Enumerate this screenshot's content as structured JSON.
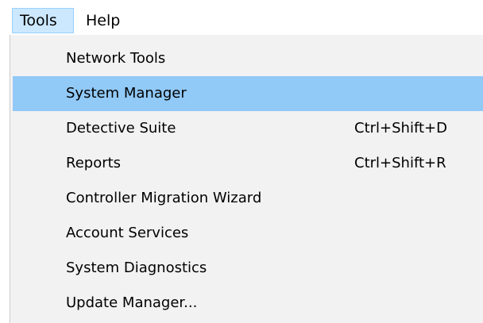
{
  "menubar": {
    "items": [
      {
        "label": "Tools"
      },
      {
        "label": "Help"
      }
    ]
  },
  "dropdown": {
    "items": [
      {
        "label": "Network Tools",
        "shortcut": ""
      },
      {
        "label": "System Manager",
        "shortcut": ""
      },
      {
        "label": "Detective Suite",
        "shortcut": "Ctrl+Shift+D"
      },
      {
        "label": "Reports",
        "shortcut": "Ctrl+Shift+R"
      },
      {
        "label": "Controller Migration Wizard",
        "shortcut": ""
      },
      {
        "label": "Account Services",
        "shortcut": ""
      },
      {
        "label": "System Diagnostics",
        "shortcut": ""
      },
      {
        "label": "Update Manager...",
        "shortcut": ""
      }
    ],
    "highlighted_item": "System Manager"
  },
  "colors": {
    "menubar_selected_bg": "#cce8ff",
    "menubar_selected_border": "#99d1ff",
    "dropdown_bg": "#f2f2f2",
    "item_highlight_bg": "#91c9f7"
  }
}
